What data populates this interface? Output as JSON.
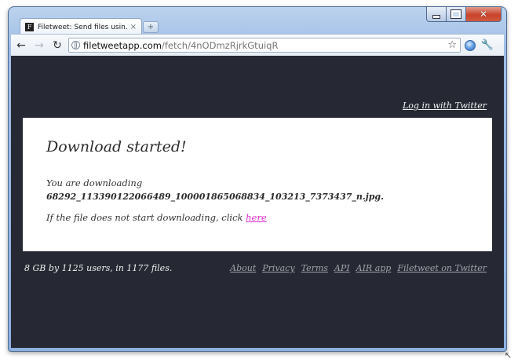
{
  "browser": {
    "tab_title": "Filetweet: Send files usin...",
    "tab_close": "×",
    "new_tab": "+",
    "favicon_letter": "F",
    "url_host": "filetweetapp.com",
    "url_path": "/fetch/4nODmzRjrkGtuiqR",
    "icons": {
      "back": "back-arrow-icon",
      "forward": "forward-arrow-icon",
      "reload": "reload-icon",
      "bookmark": "star-icon",
      "page": "chrome-page-icon",
      "settings": "wrench-icon"
    }
  },
  "page": {
    "login_link": "Log in with Twitter",
    "heading": "Download started!",
    "downloading_label": "You are downloading",
    "filename": "68292_113390122066489_100001865068834_103213_7373437_n.jpg.",
    "nostart_text": "If the file does not start downloading, click ",
    "here_link": "here",
    "stats": "8 GB by 1125 users, in 1177 files.",
    "footer_links": [
      "About",
      "Privacy",
      "Terms",
      "API",
      "AIR app",
      "Filetweet on Twitter"
    ]
  },
  "colors": {
    "page_background": "#262833",
    "card_background": "#ffffff",
    "here_link": "#e22bd0",
    "footer_link": "#a0a2ab"
  }
}
